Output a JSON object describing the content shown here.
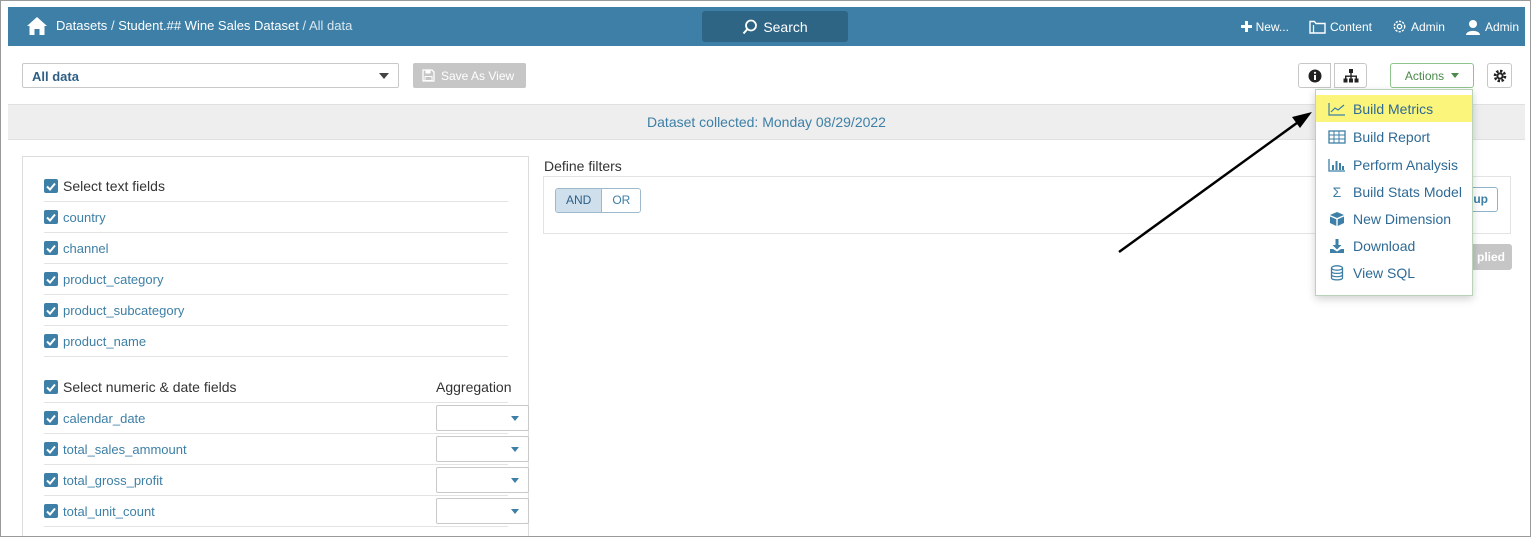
{
  "nav": {
    "breadcrumb_datasets": "Datasets",
    "breadcrumb_sep": "/",
    "breadcrumb_dataset": "Student.## Wine Sales Dataset",
    "breadcrumb_current": "/ All data",
    "search_label": "Search",
    "new_label": "New...",
    "content_label": "Content",
    "admin_settings_label": "Admin",
    "user_label": "Admin",
    "bar_color": "#3d7fa6"
  },
  "toolbar": {
    "view_select_value": "All data",
    "save_as_view_label": "Save As View",
    "actions_label": "Actions"
  },
  "dataset_collected": "Dataset collected: Monday 08/29/2022",
  "fields": {
    "text_header": "Select text fields",
    "text_fields": [
      "country",
      "channel",
      "product_category",
      "product_subcategory",
      "product_name"
    ],
    "numeric_header": "Select numeric & date fields",
    "aggregation_header": "Aggregation",
    "numeric_fields": [
      "calendar_date",
      "total_sales_ammount",
      "total_gross_profit",
      "total_unit_count"
    ]
  },
  "filters": {
    "title": "Define filters",
    "and_label": "AND",
    "or_label": "OR",
    "add_group_label": "up",
    "applied_label": "plied"
  },
  "actions_menu": {
    "items": [
      {
        "label": "Build Metrics",
        "icon": "line-chart-icon",
        "highlighted": true
      },
      {
        "label": "Build Report",
        "icon": "table-icon",
        "highlighted": false
      },
      {
        "label": "Perform Analysis",
        "icon": "bar-chart-icon",
        "highlighted": false
      },
      {
        "label": "Build Stats Model",
        "icon": "sigma-icon",
        "highlighted": false
      },
      {
        "label": "New Dimension",
        "icon": "cubes-icon",
        "highlighted": false
      },
      {
        "label": "Download",
        "icon": "download-icon",
        "highlighted": false
      },
      {
        "label": "View SQL",
        "icon": "database-icon",
        "highlighted": false
      }
    ],
    "highlight_color": "#fbf57c"
  }
}
